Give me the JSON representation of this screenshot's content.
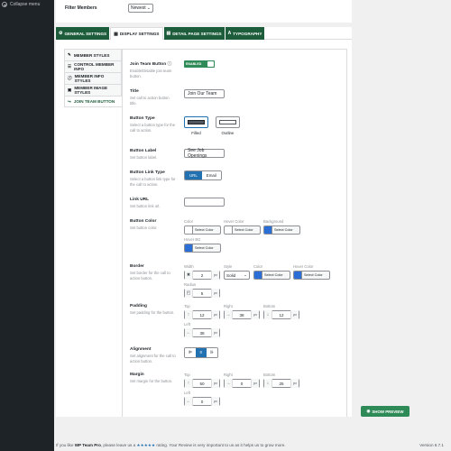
{
  "sidebar": {
    "collapse_label": "Collapse menu"
  },
  "filter": {
    "label": "Filter Members",
    "selected": "Newest"
  },
  "tabs": [
    {
      "label": "GENERAL SETTINGS",
      "icon": "gear-icon"
    },
    {
      "label": "DISPLAY SETTINGS",
      "icon": "grid-icon"
    },
    {
      "label": "DETAIL PAGE SETTINGS",
      "icon": "page-icon"
    },
    {
      "label": "TYPOGRAPHY",
      "icon": "font-icon"
    }
  ],
  "subnav": [
    {
      "label": "MEMBER STYLES"
    },
    {
      "label": "CONTROL MEMBER INFO"
    },
    {
      "label": "MEMBER INFO STYLES"
    },
    {
      "label": "MEMBER IMAGE STYLES"
    },
    {
      "label": "JOIN TEAM BUTTON"
    }
  ],
  "fields": {
    "join_team": {
      "title": "Join Team Button",
      "desc": "Enable/Disable join team button.",
      "toggle": "ENABLED"
    },
    "title": {
      "title": "Title",
      "desc": "Set call to action button title.",
      "value": "Join Our Team"
    },
    "button_type": {
      "title": "Button Type",
      "desc": "Select a button type for the call to action.",
      "options": [
        "Filled",
        "Outline"
      ],
      "selected": "Filled"
    },
    "button_label": {
      "title": "Button Label",
      "desc": "Set button label.",
      "value": "See Job Openings"
    },
    "link_type": {
      "title": "Button Link Type",
      "desc": "Select a button link type for the call to action.",
      "options": [
        "URL",
        "Email"
      ],
      "selected": "URL"
    },
    "link_url": {
      "title": "Link URL",
      "desc": "Set button link url.",
      "value": ""
    },
    "button_color": {
      "title": "Button Color",
      "desc": "Set button color.",
      "items": [
        {
          "label": "Color",
          "button": "Select Color",
          "color": "#ffffff"
        },
        {
          "label": "Hover Color",
          "button": "Select Color",
          "color": "#ffffff"
        },
        {
          "label": "Background",
          "button": "Select Color",
          "color": "#2b6fd6"
        },
        {
          "label": "Hover BG",
          "button": "Select Color",
          "color": "#2b6fd6"
        }
      ]
    },
    "border": {
      "title": "Border",
      "desc": "Set border for the call to action button.",
      "width_label": "Width",
      "width": "2",
      "unit": "px",
      "style_label": "Style",
      "style": "Solid",
      "color_label": "Color",
      "color_button": "Select Color",
      "color": "#2b6fd6",
      "hover_label": "Hover Color",
      "hover_button": "Select Color",
      "hover": "#2b6fd6",
      "radius_label": "Radius",
      "radius": "5"
    },
    "padding": {
      "title": "Padding",
      "desc": "Set padding for the button.",
      "top_label": "Top",
      "top": "12",
      "right_label": "Right",
      "right": "38",
      "bottom_label": "Bottom",
      "bottom": "12",
      "left_label": "Left",
      "left": "38",
      "unit": "px"
    },
    "alignment": {
      "title": "Alignment",
      "desc": "Set alignment for the call to action button."
    },
    "margin": {
      "title": "Margin",
      "desc": "Set margin for the button.",
      "top_label": "Top",
      "top": "50",
      "right_label": "Right",
      "right": "0",
      "bottom_label": "Bottom",
      "bottom": "25",
      "left_label": "Left",
      "left": "0",
      "unit": "px"
    }
  },
  "preview_button": "SHOW PREVIEW",
  "footer": {
    "prefix": "If you like",
    "product": "WP Team Pro",
    "middle": ", please leave us a",
    "stars": "★★★★★",
    "suffix": "rating. Your Review is very important to us as it helps us to grow more.",
    "version": "Version 6.7.1"
  },
  "colors": {
    "accent": "#1e5d3b",
    "toggle": "#2e8b57",
    "blue": "#2271b1"
  }
}
